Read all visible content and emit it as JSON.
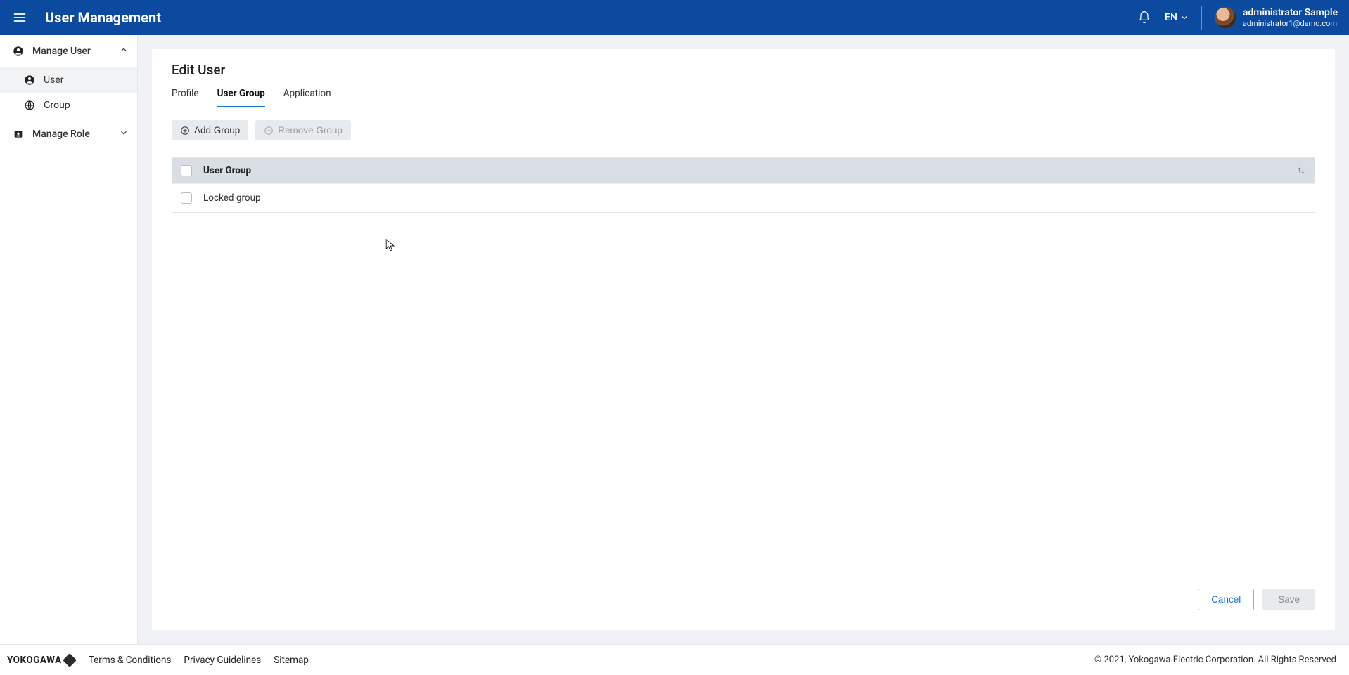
{
  "header": {
    "title": "User Management",
    "language": "EN",
    "user": {
      "name": "administrator Sample",
      "email": "administrator1@demo.com"
    }
  },
  "sidebar": {
    "sections": [
      {
        "label": "Manage User",
        "expanded": true,
        "items": [
          {
            "label": "User",
            "active": true
          },
          {
            "label": "Group",
            "active": false
          }
        ]
      },
      {
        "label": "Manage Role",
        "expanded": false,
        "items": []
      }
    ]
  },
  "main": {
    "title": "Edit User",
    "tabs": [
      {
        "label": "Profile",
        "active": false
      },
      {
        "label": "User Group",
        "active": true
      },
      {
        "label": "Application",
        "active": false
      }
    ],
    "buttons": {
      "add": "Add Group",
      "remove": "Remove Group"
    },
    "table": {
      "header": "User Group",
      "rows": [
        {
          "label": "Locked group"
        }
      ]
    },
    "footer": {
      "cancel": "Cancel",
      "save": "Save"
    }
  },
  "footer": {
    "brand": "YOKOGAWA",
    "links": [
      "Terms & Conditions",
      "Privacy Guidelines",
      "Sitemap"
    ],
    "copyright": "© 2021, Yokogawa Electric Corporation. All Rights Reserved"
  }
}
